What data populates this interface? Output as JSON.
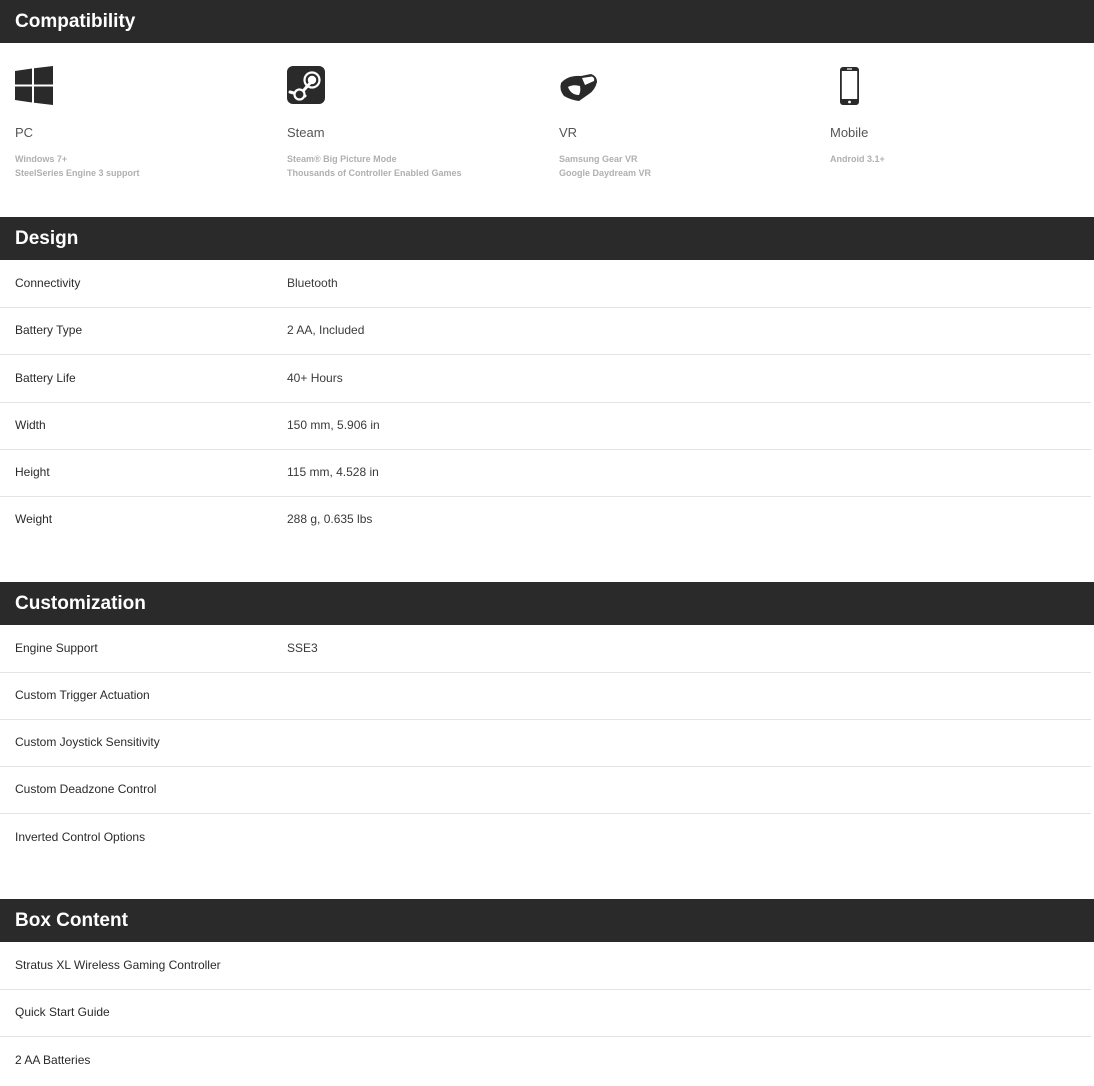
{
  "compatibility": {
    "title": "Compatibility",
    "platforms": [
      {
        "icon": "windows-icon",
        "name": "PC",
        "details": [
          "Windows 7+",
          "SteelSeries Engine 3 support"
        ]
      },
      {
        "icon": "steam-icon",
        "name": "Steam",
        "details": [
          "Steam® Big Picture Mode",
          "Thousands of Controller Enabled Games"
        ]
      },
      {
        "icon": "vr-headset-icon",
        "name": "VR",
        "details": [
          "Samsung Gear VR",
          "Google Daydream VR"
        ]
      },
      {
        "icon": "smartphone-icon",
        "name": "Mobile",
        "details": [
          "Android 3.1+"
        ]
      }
    ]
  },
  "design": {
    "title": "Design",
    "rows": [
      {
        "label": "Connectivity",
        "value": "Bluetooth"
      },
      {
        "label": "Battery Type",
        "value": "2 AA, Included"
      },
      {
        "label": "Battery Life",
        "value": "40+ Hours"
      },
      {
        "label": "Width",
        "value": "150 mm, 5.906 in"
      },
      {
        "label": "Height",
        "value": "115 mm, 4.528 in"
      },
      {
        "label": "Weight",
        "value": "288 g, 0.635 lbs"
      }
    ]
  },
  "customization": {
    "title": "Customization",
    "rows": [
      {
        "label": "Engine Support",
        "value": "SSE3"
      },
      {
        "label": "Custom Trigger Actuation",
        "value": ""
      },
      {
        "label": "Custom Joystick Sensitivity",
        "value": ""
      },
      {
        "label": "Custom Deadzone Control",
        "value": ""
      },
      {
        "label": "Inverted Control Options",
        "value": ""
      }
    ]
  },
  "box_content": {
    "title": "Box Content",
    "items": [
      "Stratus XL Wireless Gaming Controller",
      "Quick Start Guide",
      "2 AA Batteries"
    ]
  }
}
